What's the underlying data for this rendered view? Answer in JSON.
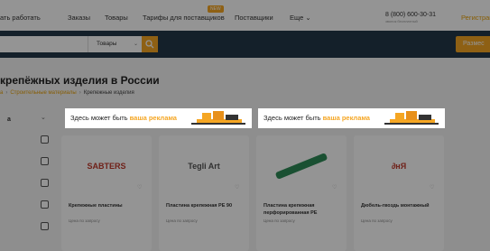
{
  "nav": {
    "items": [
      "ать работать",
      "Заказы",
      "Товары",
      "Тарифы для поставщиков",
      "Поставщики",
      "Еще"
    ],
    "new_badge": "NEW",
    "phone": "8 (800) 600-30-31",
    "phone_note": "звонок бесплатный",
    "register": "Регистрац"
  },
  "search": {
    "category": "Товары",
    "place_button": "Размес"
  },
  "page": {
    "title": "крепёжных изделия в России",
    "breadcrumbs": [
      "а",
      "Строительные материалы"
    ],
    "current_crumb": "Крепежные изделия"
  },
  "sidebar": {
    "heading": "а",
    "checkbox_count": 5
  },
  "ads": [
    {
      "text": "Здесь может быть ",
      "highlight": "ваша реклама"
    },
    {
      "text": "Здесь может быть ",
      "highlight": "ваша реклама"
    }
  ],
  "products": [
    {
      "brand": "SABTERS",
      "label": "Крепежные пластины",
      "meta": "Цена по запросу"
    },
    {
      "brand": "Tegli Art",
      "label": "Пластина крепежная PE 90",
      "meta": "Цена по запросу"
    },
    {
      "brand": "",
      "label": "Пластина крепежная перфорированная PE",
      "meta": "Цена по запросу"
    },
    {
      "brand": "∂нЯ",
      "label": "Дюбель-гвоздь монтажный",
      "meta": "Цена по запросу"
    }
  ],
  "colors": {
    "accent": "#f5a623",
    "navy": "#243749"
  }
}
